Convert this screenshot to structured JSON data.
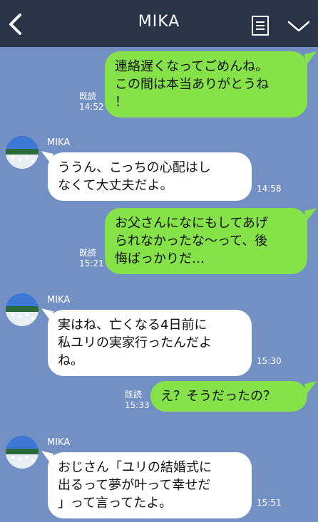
{
  "header": {
    "title": "MIKA"
  },
  "messages": [
    {
      "side": "out",
      "lines": "連絡遅くなってごめんね。\nこの間は本当ありがとうね\n！",
      "read": "既読",
      "time": "14:52"
    },
    {
      "side": "in",
      "sender": "MIKA",
      "lines": "ううん、こっちの心配はし\nなくて大丈夫だよ。",
      "time": "14:58"
    },
    {
      "side": "out",
      "lines": "お父さんになにもしてあげ\nられなかったな～って、後\n悔ばっかりだ…",
      "read": "既読",
      "time": "15:21"
    },
    {
      "side": "in",
      "sender": "MIKA",
      "lines": "実はね、亡くなる4日前に\n私ユリの実家行ったんだよ\nね。",
      "time": "15:30"
    },
    {
      "side": "out",
      "lines": "え？そうだったの？",
      "read": "既読",
      "time": "15:33"
    },
    {
      "side": "in",
      "sender": "MIKA",
      "lines": "おじさん「ユリの結婚式に\n出るって夢が叶って幸せだ\n」って言ってたよ。",
      "time": "15:51"
    }
  ],
  "colors": {
    "background": "#7290c4",
    "header": "#2a3448",
    "outgoing_bubble": "#85e249",
    "incoming_bubble": "#ffffff"
  },
  "icons": {
    "back": "chevron-left-icon",
    "menu": "note-list-icon",
    "expand": "chevron-down-icon",
    "avatar": "flower-field-avatar"
  }
}
